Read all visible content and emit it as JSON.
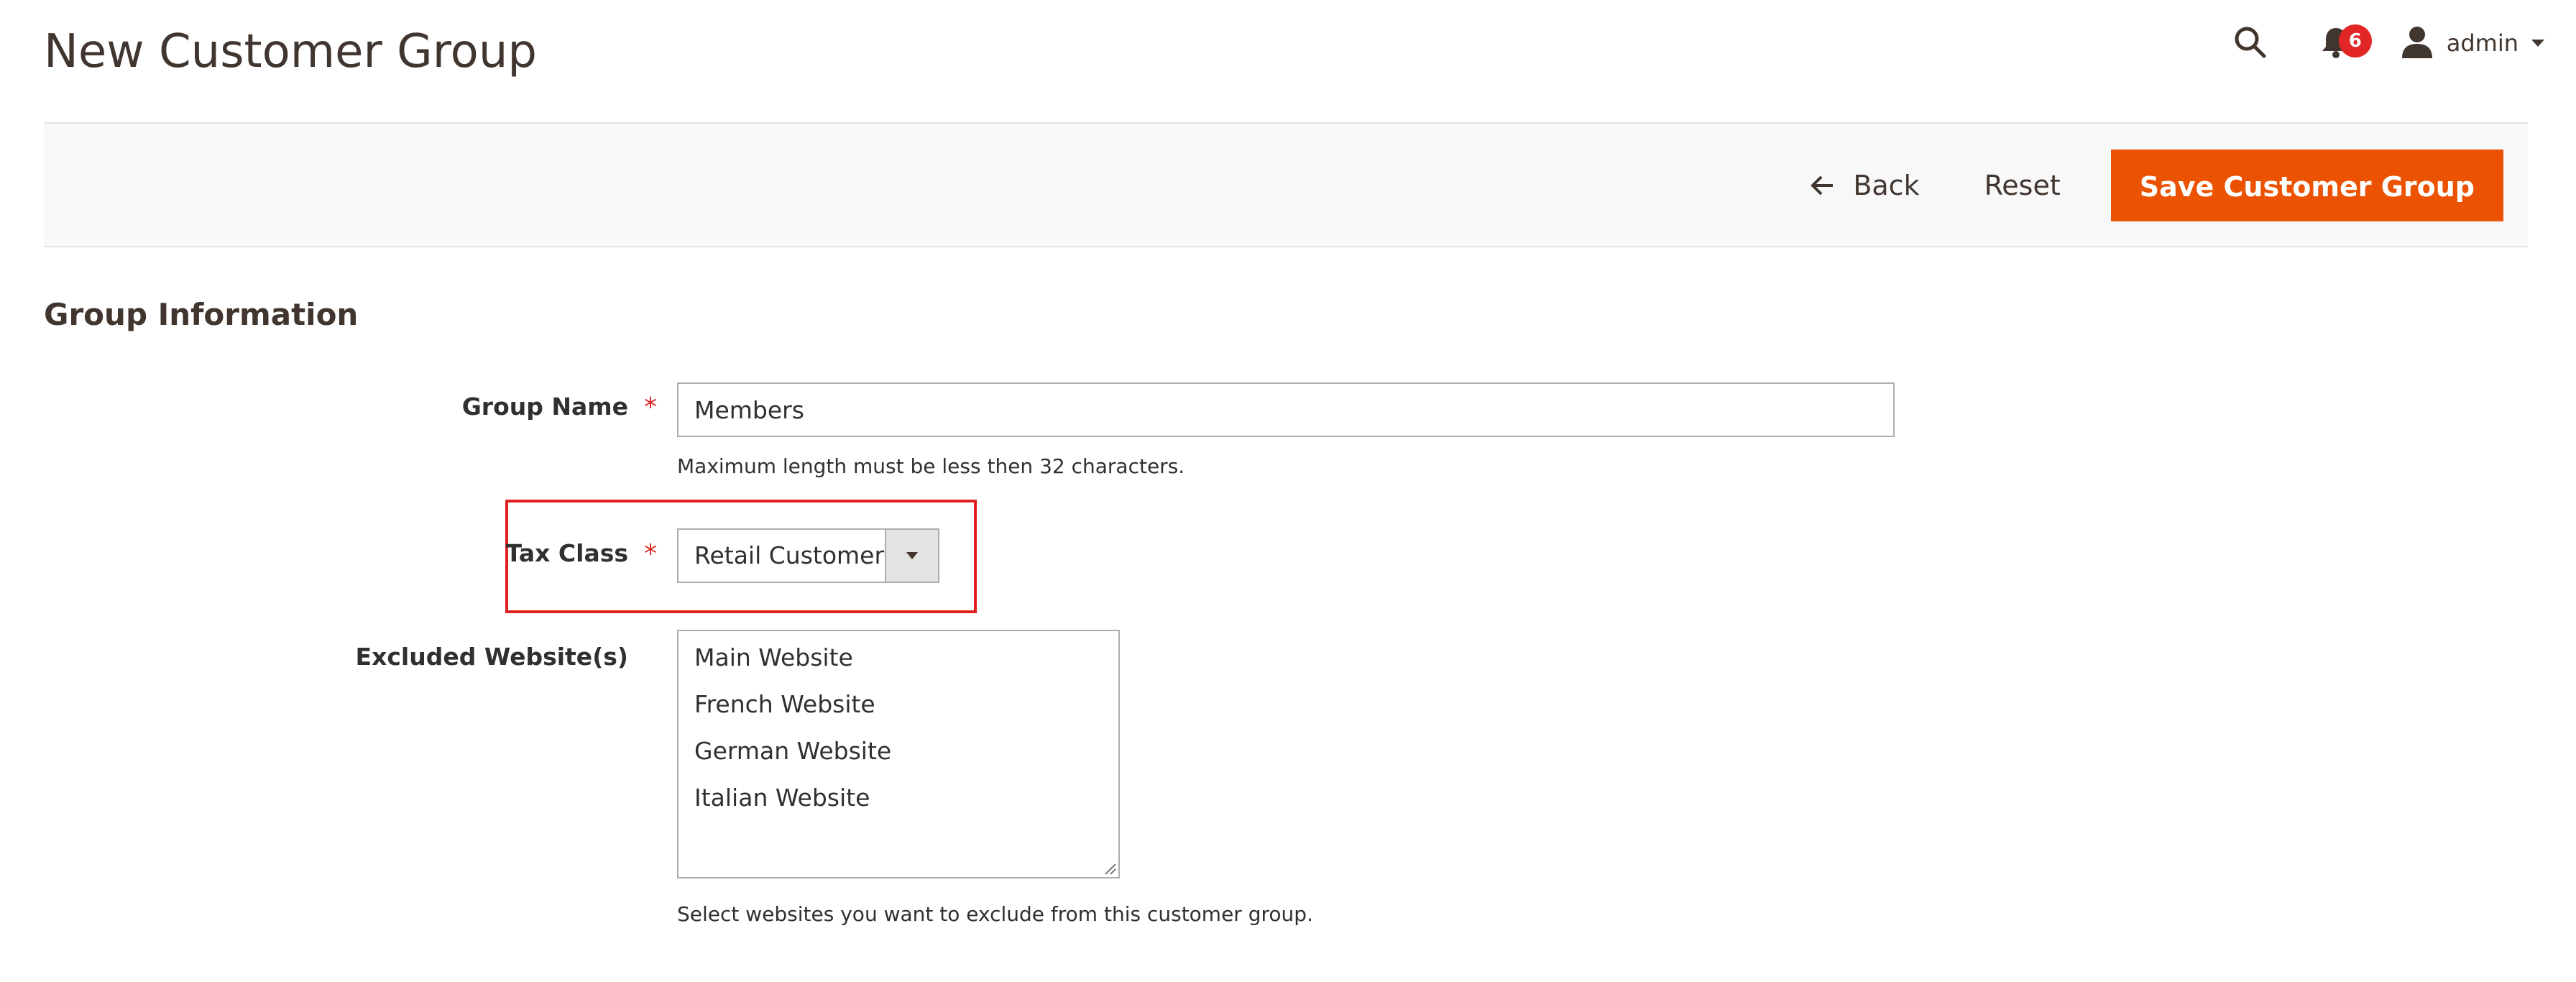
{
  "header": {
    "title": "New Customer Group",
    "notifications_count": "6",
    "user_name": "admin"
  },
  "actions": {
    "back_label": "Back",
    "reset_label": "Reset",
    "save_label": "Save Customer Group"
  },
  "section": {
    "title": "Group Information"
  },
  "fields": {
    "group_name": {
      "label": "Group Name",
      "required_mark": "*",
      "value": "Members",
      "note": "Maximum length must be less then 32 characters."
    },
    "tax_class": {
      "label": "Tax Class",
      "required_mark": "*",
      "selected": "Retail Customer"
    },
    "excluded_websites": {
      "label": "Excluded Website(s)",
      "options": [
        "Main Website",
        "French Website",
        "German Website",
        "Italian Website"
      ],
      "note": "Select websites you want to exclude from this customer group."
    }
  },
  "colors": {
    "primary_button": "#eb5202",
    "badge": "#e22626",
    "highlight": "#e0201f"
  },
  "icons": {
    "search": "search-icon",
    "notifications": "bell-icon",
    "user": "user-icon",
    "back": "arrow-left-icon",
    "select": "chevron-down-icon"
  }
}
